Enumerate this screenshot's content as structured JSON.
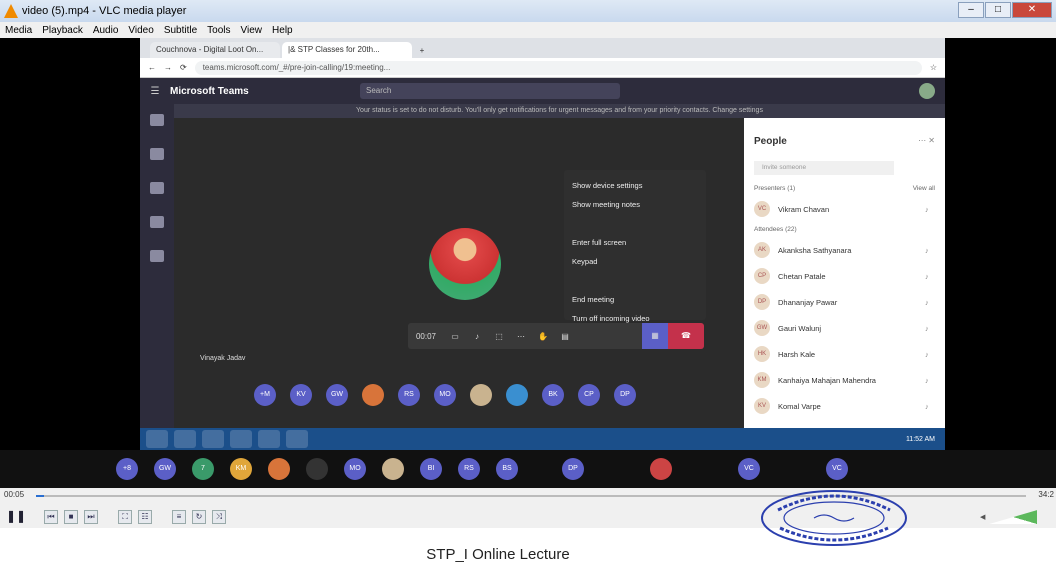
{
  "vlc": {
    "title": "video (5).mp4 - VLC media player",
    "menu": [
      "Media",
      "Playback",
      "Audio",
      "Video",
      "Subtitle",
      "Tools",
      "View",
      "Help"
    ],
    "time_elapsed": "00:05",
    "time_total": "34:2",
    "volume": "100%",
    "progress_fraction": 0.008
  },
  "browser": {
    "tabs": [
      "Couchnova - Digital Loot On...",
      "|& STP Classes for 20th..."
    ],
    "url": "teams.microsoft.com/_#/pre-join-calling/19:meeting..."
  },
  "teams": {
    "app_name": "Microsoft Teams",
    "search_placeholder": "Search",
    "banner": "Your status is set to do not disturb. You'll only get notifications for urgent messages and from your priority contacts. Change settings",
    "menu_items": [
      "Show device settings",
      "Show meeting notes",
      "",
      "Enter full screen",
      "Keypad",
      "",
      "End meeting",
      "Turn off incoming video"
    ],
    "call_timer": "00:07",
    "presenter_name": "Vinayak Jadav",
    "attendee_initials": [
      "+M",
      "KV",
      "GW",
      "",
      "RS",
      "MO",
      "",
      "",
      "BK",
      "CP",
      "DP"
    ]
  },
  "people": {
    "title": "People",
    "filter_placeholder": "Invite someone",
    "presenters_label": "Presenters (1)",
    "view_all": "View all",
    "attendees_label": "Attendees (22)",
    "rows": [
      {
        "initials": "VC",
        "name": "Vikram Chavan"
      },
      {
        "initials": "AK",
        "name": "Akanksha Sathyanara"
      },
      {
        "initials": "CP",
        "name": "Chetan Patale"
      },
      {
        "initials": "DP",
        "name": "Dhananjay Pawar"
      },
      {
        "initials": "GW",
        "name": "Gauri Walunj"
      },
      {
        "initials": "HK",
        "name": "Harsh Kale"
      },
      {
        "initials": "KM",
        "name": "Kanhaiya Mahajan Mahendra"
      },
      {
        "initials": "KV",
        "name": "Komal Varpe"
      }
    ]
  },
  "taskbar": {
    "clock": "11:52 AM"
  },
  "strip_initials": [
    "+8",
    "GW",
    "7",
    "KM",
    "",
    "",
    "MO",
    "",
    "BI",
    "RS",
    "BS",
    "DP",
    "",
    "VC",
    "VC"
  ],
  "caption": "STP_I Online Lecture",
  "colors": {
    "teams_purple": "#5b5fc7",
    "hangup_red": "#c4314b",
    "taskbar_blue": "#1b4f8a"
  }
}
